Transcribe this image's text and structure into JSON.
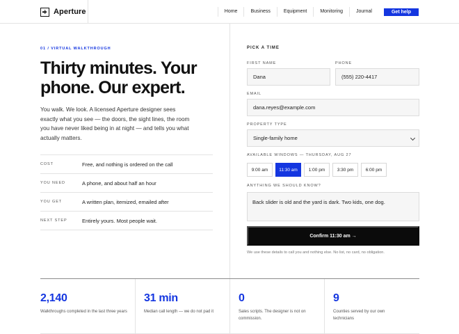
{
  "header": {
    "brand": "Aperture",
    "nav": [
      "Home",
      "Business",
      "Equipment",
      "Monitoring",
      "Journal"
    ],
    "cta": "Get help"
  },
  "hero": {
    "eyebrow": "01 / Virtual walkthrough",
    "headline": "Thirty minutes. Your phone. Our expert.",
    "intro": "You walk. We look. A licensed Aperture designer sees exactly what you see — the doors, the sight lines, the room you have never liked being in at night — and tells you what actually matters.",
    "facts": [
      {
        "key": "Cost",
        "value": "Free, and nothing is ordered on the call"
      },
      {
        "key": "You need",
        "value": "A phone, and about half an hour"
      },
      {
        "key": "You get",
        "value": "A written plan, itemized, emailed after"
      },
      {
        "key": "Next step",
        "value": "Entirely yours. Most people wait."
      }
    ]
  },
  "form": {
    "title": "Pick a time",
    "first_name_label": "First name",
    "first_name_value": "Dana",
    "phone_label": "Phone",
    "phone_value": "(555) 220-4417",
    "email_label": "Email",
    "email_value": "dana.reyes@example.com",
    "property_label": "Property type",
    "property_value": "Single-family home",
    "windows_label": "Available windows — Thursday, Aug 27",
    "slots": [
      "9:00 am",
      "11:30 am",
      "1:00 pm",
      "3:30 pm",
      "6:00 pm"
    ],
    "selected_slot": "11:30 am",
    "notes_label": "Anything we should know?",
    "notes_value": "Back slider is old and the yard is dark. Two kids, one dog.",
    "submit": "Confirm 11:30 am →",
    "disclaimer": "We use these details to call you and nothing else. No list, no card, no obligation."
  },
  "stats": [
    {
      "value": "2,140",
      "desc": "Walkthroughs completed in the last three years"
    },
    {
      "value": "31 min",
      "desc": "Median call length — we do not pad it"
    },
    {
      "value": "0",
      "desc": "Sales scripts. The designer is not on commission."
    },
    {
      "value": "9",
      "desc": "Counties served by our own technicians"
    }
  ],
  "colors": {
    "accent": "#1436e0",
    "button": "#0b0b0b"
  }
}
